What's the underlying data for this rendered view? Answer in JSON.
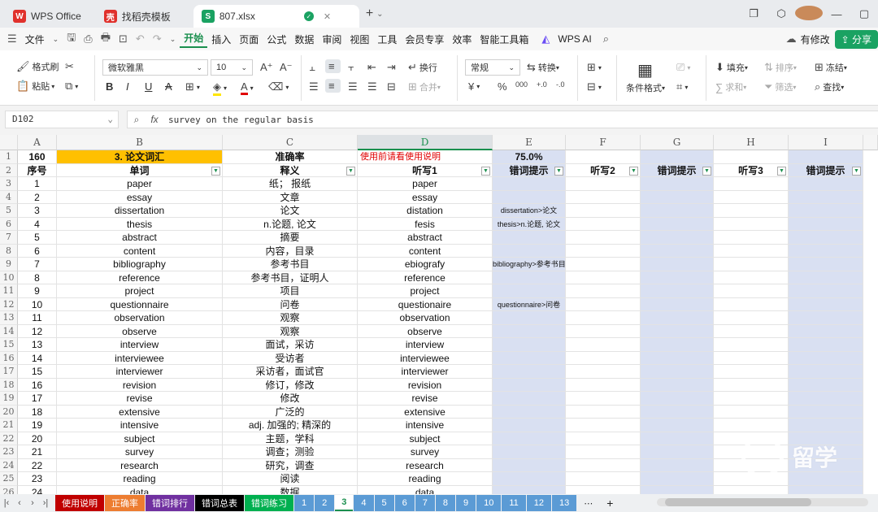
{
  "tabs": [
    {
      "label": "WPS Office",
      "logo": "W",
      "color": "#e0312c"
    },
    {
      "label": "找稻壳模板",
      "logo": "壳",
      "color": "#e0312c"
    },
    {
      "label": "807.xlsx",
      "logo": "S",
      "color": "#1aa262"
    }
  ],
  "menu": {
    "file": "文件",
    "items": [
      "开始",
      "插入",
      "页面",
      "公式",
      "数据",
      "审阅",
      "视图",
      "工具",
      "会员专享",
      "效率",
      "智能工具箱"
    ],
    "wps_ai": "WPS AI",
    "modified": "有修改",
    "share": "分享"
  },
  "ribbon": {
    "format_painter": "格式刷",
    "paste": "粘贴",
    "font_name": "微软雅黑",
    "font_size": "10",
    "wrap": "换行",
    "merge": "合并",
    "number_format": "常规",
    "convert": "转换",
    "conditional_format": "条件格式",
    "fill": "填充",
    "sort": "排序",
    "freeze": "冻结",
    "sum": "求和",
    "filter": "筛选",
    "find": "查找"
  },
  "formula_bar": {
    "cell_ref": "D102",
    "fx": "fx",
    "content": "survey on the regular basis"
  },
  "columns": [
    "A",
    "B",
    "C",
    "D",
    "E",
    "F",
    "G",
    "H",
    "I"
  ],
  "row1": {
    "a": "160",
    "b": "3. 论文词汇",
    "c": "准确率",
    "d": "使用前请看使用说明",
    "e": "75.0%"
  },
  "headers": [
    "序号",
    "单词",
    "释义",
    "听写1",
    "错词提示",
    "听写2",
    "错词提示",
    "听写3",
    "错词提示"
  ],
  "rows": [
    [
      "1",
      "paper",
      "纸； 报纸",
      "paper",
      ""
    ],
    [
      "2",
      "essay",
      "文章",
      "essay",
      ""
    ],
    [
      "3",
      "dissertation",
      "论文",
      "distation",
      "dissertation>论文"
    ],
    [
      "4",
      "thesis",
      "n.论题, 论文",
      "fesis",
      "thesis>n.论题, 论文"
    ],
    [
      "5",
      "abstract",
      "摘要",
      "abstract",
      ""
    ],
    [
      "6",
      "content",
      "内容，目录",
      "content",
      ""
    ],
    [
      "7",
      "bibliography",
      "参考书目",
      "ebiografy",
      "bibliography>参考书目"
    ],
    [
      "8",
      "reference",
      "参考书目，证明人",
      "reference",
      ""
    ],
    [
      "9",
      "project",
      "项目",
      "project",
      ""
    ],
    [
      "10",
      "questionnaire",
      "问卷",
      "questionaire",
      "questionnaire>问卷"
    ],
    [
      "11",
      "observation",
      "观察",
      "observation",
      ""
    ],
    [
      "12",
      "observe",
      "观察",
      "observe",
      ""
    ],
    [
      "13",
      "interview",
      "面试，采访",
      "interview",
      ""
    ],
    [
      "14",
      "interviewee",
      "受访者",
      "interviewee",
      ""
    ],
    [
      "15",
      "interviewer",
      "采访者，面试官",
      "interviewer",
      ""
    ],
    [
      "16",
      "revision",
      "修订，修改",
      "revision",
      ""
    ],
    [
      "17",
      "revise",
      "修改",
      "revise",
      ""
    ],
    [
      "18",
      "extensive",
      "广泛的",
      "extensive",
      ""
    ],
    [
      "19",
      "intensive",
      "adj. 加强的; 精深的",
      "intensive",
      ""
    ],
    [
      "20",
      "subject",
      "主题，学科",
      "subject",
      ""
    ],
    [
      "21",
      "survey",
      "调查；测验",
      "survey",
      ""
    ],
    [
      "22",
      "research",
      "研究，调查",
      "research",
      ""
    ],
    [
      "23",
      "reading",
      "阅读",
      "reading",
      ""
    ],
    [
      "24",
      "data",
      "数据",
      "data",
      ""
    ]
  ],
  "sheet_tabs": [
    {
      "label": "使用说明",
      "bg": "#c00000",
      "fg": "#ffffff"
    },
    {
      "label": "正确率",
      "bg": "#ed7d31",
      "fg": "#ffffff"
    },
    {
      "label": "错词排行",
      "bg": "#7030a0",
      "fg": "#ffffff"
    },
    {
      "label": "错词总表",
      "bg": "#000000",
      "fg": "#ffffff"
    },
    {
      "label": "错词练习",
      "bg": "#00b050",
      "fg": "#ffffff"
    }
  ],
  "numbered_sheets": [
    "1",
    "2",
    "3",
    "4",
    "5",
    "6",
    "7",
    "8",
    "9",
    "10",
    "11",
    "12",
    "13"
  ],
  "current_sheet": "3",
  "more_label": "⋯",
  "add_label": "+",
  "watermark": "留学"
}
